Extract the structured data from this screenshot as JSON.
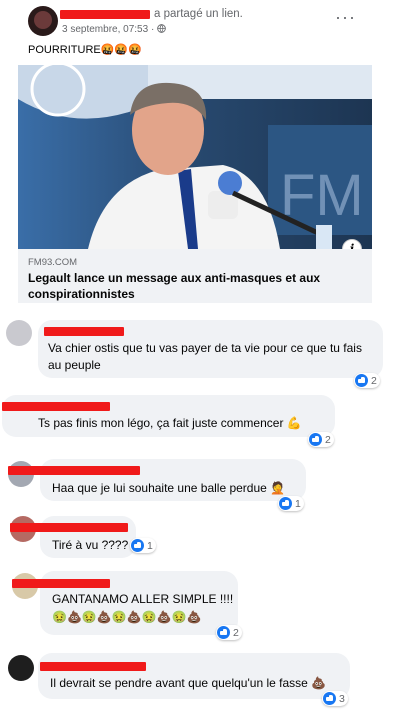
{
  "post": {
    "author_suffix": "a partagé un lien.",
    "date": "3 septembre, 07:53 · ",
    "privacy_icon": "globe-icon",
    "text": "POURRITURE🤬🤬🤬",
    "more_icon": "more-options-icon",
    "more_label": "···"
  },
  "link": {
    "domain": "FM93.COM",
    "title": "Legault lance un message aux anti-masques et aux conspirationnistes",
    "info_label": "i"
  },
  "comments": [
    {
      "text": "Va chier ostis que tu vas payer de ta vie pour ce que tu fais au peuple",
      "likes": "2"
    },
    {
      "text": "Ts pas finis mon légo, ça fait juste commencer 💪",
      "likes": "2"
    },
    {
      "text": "Haa que je lui souhaite une balle perdue 🤦",
      "likes": "1"
    },
    {
      "text": "Tiré à vu ????",
      "likes": "1"
    },
    {
      "text": "GANTANAMO ALLER SIMPLE !!!!",
      "text2": "🤢💩🤢💩🤢💩🤢💩🤢💩",
      "likes": "2"
    },
    {
      "text": "Il devrait se pendre avant que quelqu'un le fasse 💩",
      "likes": "3"
    }
  ],
  "colors": {
    "redaction": "#f01a1a",
    "like": "#1877f2",
    "bubble": "#f0f2f5"
  }
}
